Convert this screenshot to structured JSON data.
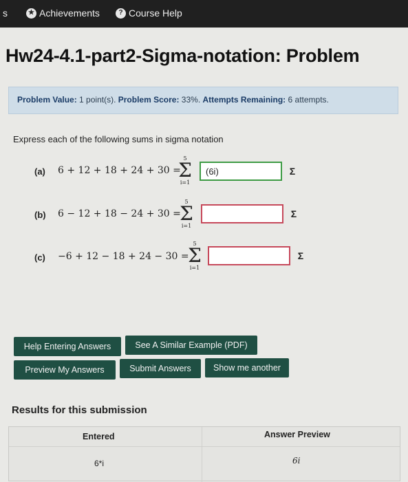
{
  "nav": {
    "fragment": "s",
    "achievements": "Achievements",
    "course_help": "Course Help"
  },
  "title": "Hw24-4.1-part2-Sigma-notation: Problem",
  "info": {
    "value_label": "Problem Value:",
    "value": "1 point(s).",
    "score_label": "Problem Score:",
    "score": "33%.",
    "attempts_label": "Attempts Remaining:",
    "attempts": "6 attempts."
  },
  "prompt": "Express each of the following sums in sigma notation",
  "problems": [
    {
      "label": "(a)",
      "expr": "6 + 12 + 18 + 24 + 30 =",
      "upper": "5",
      "lower": "i=1",
      "answer": "(6i)",
      "status": "correct"
    },
    {
      "label": "(b)",
      "expr": "6 − 12 + 18 − 24 + 30 =",
      "upper": "5",
      "lower": "i=1",
      "answer": "",
      "status": "incorrect"
    },
    {
      "label": "(c)",
      "expr": "−6 + 12 − 18 + 24 − 30 =",
      "upper": "5",
      "lower": "i=1",
      "answer": "",
      "status": "incorrect"
    }
  ],
  "sigma_symbol": "Σ",
  "sigma_button": "Σ",
  "buttons": {
    "help_entering": "Help Entering Answers",
    "similar_example": "See A Similar Example (PDF)",
    "preview": "Preview My Answers",
    "submit": "Submit Answers",
    "show_another": "Show me another"
  },
  "results": {
    "heading": "Results for this submission",
    "col_entered": "Entered",
    "col_preview": "Answer Preview",
    "rows": [
      {
        "entered": "6*i",
        "preview": "6i"
      }
    ]
  },
  "colors": {
    "nav_bg": "#202020",
    "info_bg": "#cfdde8",
    "button_bg": "#1f4f43",
    "correct_border": "#3d9b44",
    "incorrect_border": "#c6485a"
  }
}
